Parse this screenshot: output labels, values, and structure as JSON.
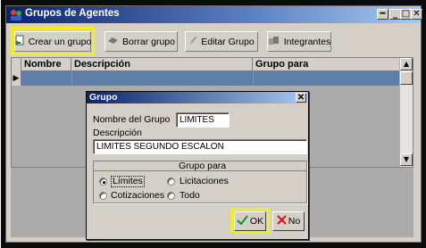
{
  "window": {
    "title": "Grupos de Agentes"
  },
  "toolbar": {
    "crear": "Crear un grupo",
    "borrar": "Borrar grupo",
    "editar": "Editar Grupo",
    "integrantes": "Integrantes"
  },
  "grid": {
    "columns": [
      "Nombre",
      "Descripción",
      "Grupo para"
    ]
  },
  "dialog": {
    "title": "Grupo",
    "nombre_label": "Nombre del Grupo",
    "nombre_value": "LIMITES",
    "descripcion_label": "Descripción",
    "descripcion_value": "LIMITES SEGUNDO ESCALON",
    "grupo_para_label": "Grupo para",
    "options": [
      "Límites",
      "Licitaciones",
      "Cotizaciones",
      "Todo"
    ],
    "selected": "Límites",
    "ok_label": "OK",
    "no_label": "No"
  },
  "colors": {
    "highlight": "#f4ee1a",
    "title_start": "#0a246a",
    "selected_row": "#5f7ea8"
  }
}
